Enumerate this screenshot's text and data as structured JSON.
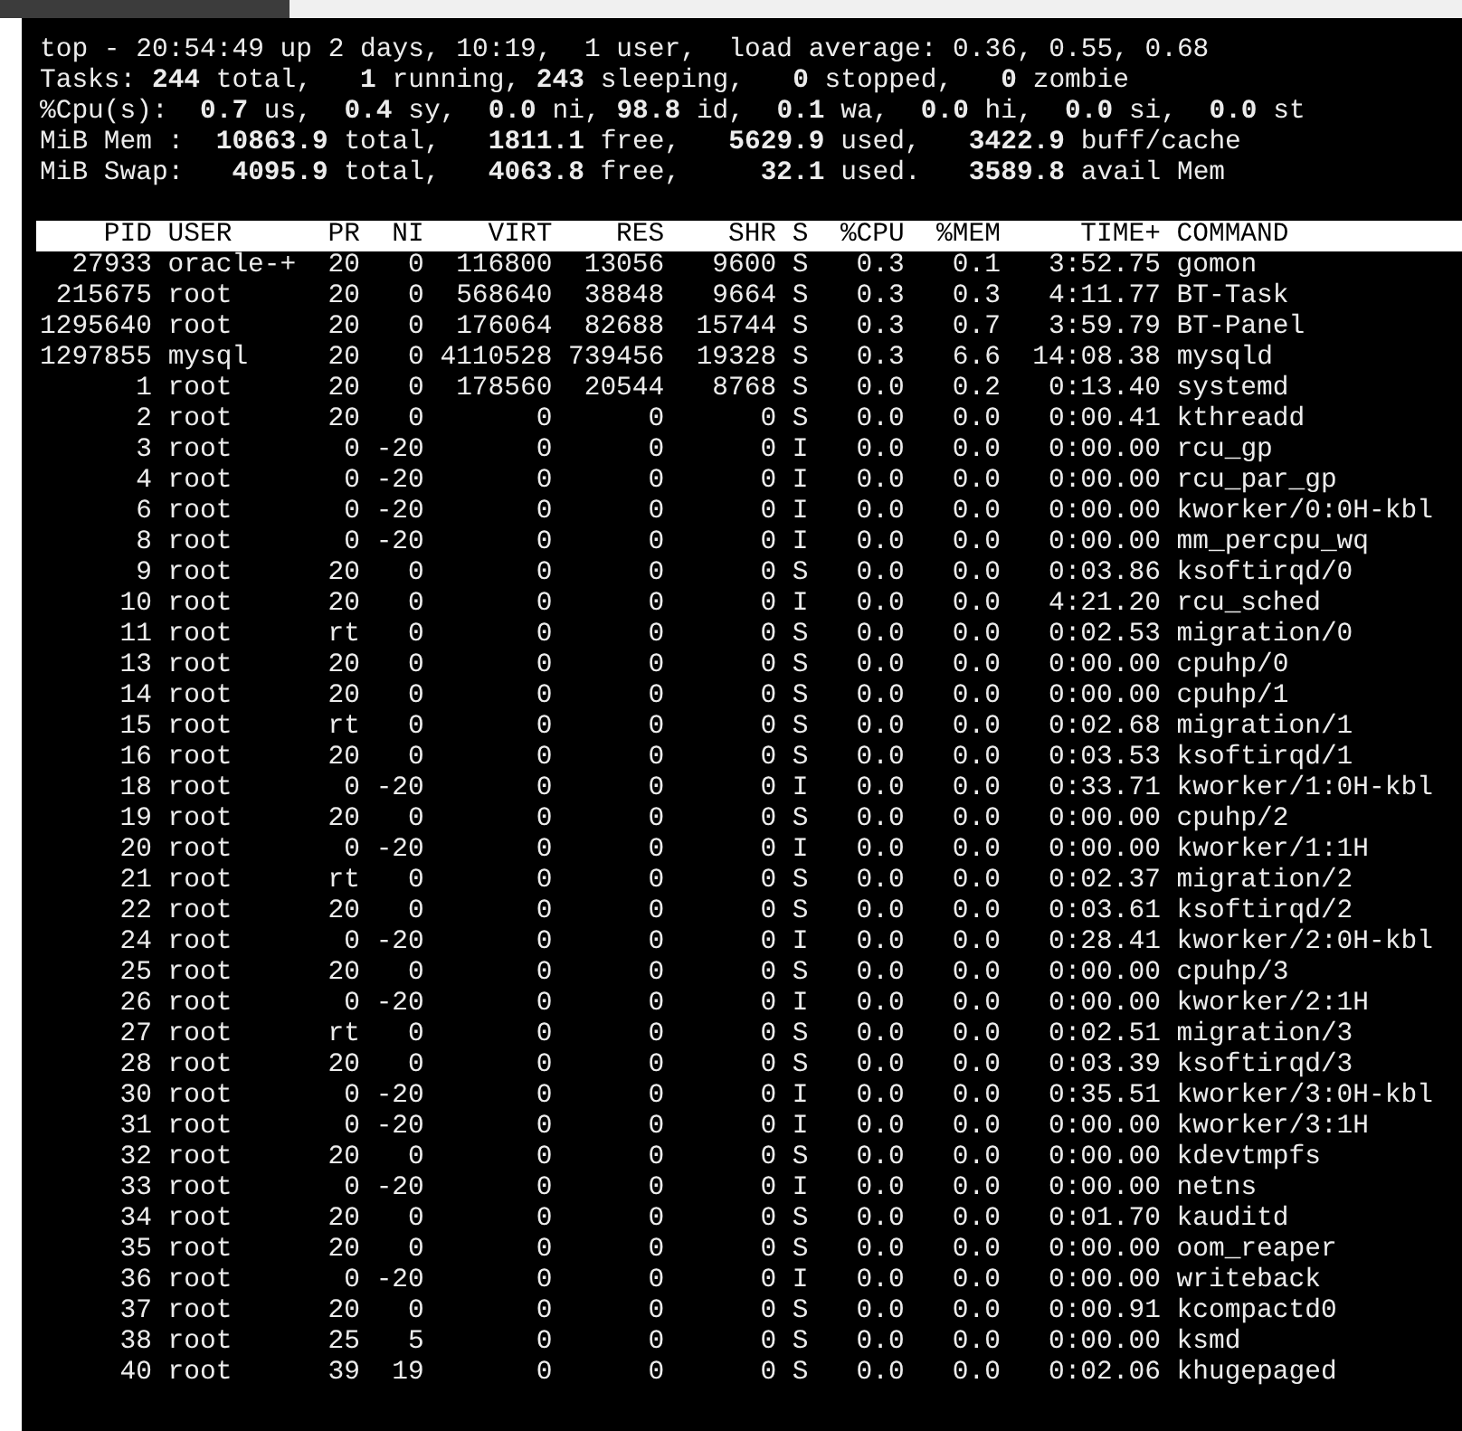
{
  "summary": [
    "top - 20:54:49 up 2 days, 10:19,  1 user,  load average: 0.36, 0.55, 0.68",
    "Tasks: **244** total,   **1** running, **243** sleeping,   **0** stopped,   **0** zombie",
    "%Cpu(s):  **0.7** us,  **0.4** sy,  **0.0** ni, **98.8** id,  **0.1** wa,  **0.0** hi,  **0.0** si,  **0.0** st",
    "MiB Mem :  **10863.9** total,   **1811.1** free,   **5629.9** used,   **3422.9** buff/cache",
    "MiB Swap:   **4095.9** total,   **4063.8** free,     **32.1** used.   **3589.8** avail Mem"
  ],
  "table": {
    "columns": [
      "PID",
      "USER",
      "PR",
      "NI",
      "VIRT",
      "RES",
      "SHR",
      "S",
      "%CPU",
      "%MEM",
      "TIME+",
      "COMMAND"
    ],
    "rows": [
      {
        "cells": [
          "27933",
          "oracle-+",
          "20",
          "0",
          "116800",
          "13056",
          "9600",
          "S",
          "0.3",
          "0.1",
          "3:52.75",
          "gomon"
        ]
      },
      {
        "cells": [
          "215675",
          "root",
          "20",
          "0",
          "568640",
          "38848",
          "9664",
          "S",
          "0.3",
          "0.3",
          "4:11.77",
          "BT-Task"
        ]
      },
      {
        "cells": [
          "1295640",
          "root",
          "20",
          "0",
          "176064",
          "82688",
          "15744",
          "S",
          "0.3",
          "0.7",
          "3:59.79",
          "BT-Panel"
        ]
      },
      {
        "cells": [
          "1297855",
          "mysql",
          "20",
          "0",
          "4110528",
          "739456",
          "19328",
          "S",
          "0.3",
          "6.6",
          "14:08.38",
          "mysqld"
        ]
      },
      {
        "cells": [
          "1",
          "root",
          "20",
          "0",
          "178560",
          "20544",
          "8768",
          "S",
          "0.0",
          "0.2",
          "0:13.40",
          "systemd"
        ]
      },
      {
        "cells": [
          "2",
          "root",
          "20",
          "0",
          "0",
          "0",
          "0",
          "S",
          "0.0",
          "0.0",
          "0:00.41",
          "kthreadd"
        ]
      },
      {
        "cells": [
          "3",
          "root",
          "0",
          "-20",
          "0",
          "0",
          "0",
          "I",
          "0.0",
          "0.0",
          "0:00.00",
          "rcu_gp"
        ]
      },
      {
        "cells": [
          "4",
          "root",
          "0",
          "-20",
          "0",
          "0",
          "0",
          "I",
          "0.0",
          "0.0",
          "0:00.00",
          "rcu_par_gp"
        ]
      },
      {
        "cells": [
          "6",
          "root",
          "0",
          "-20",
          "0",
          "0",
          "0",
          "I",
          "0.0",
          "0.0",
          "0:00.00",
          "kworker/0:0H-kbl"
        ]
      },
      {
        "cells": [
          "8",
          "root",
          "0",
          "-20",
          "0",
          "0",
          "0",
          "I",
          "0.0",
          "0.0",
          "0:00.00",
          "mm_percpu_wq"
        ]
      },
      {
        "cells": [
          "9",
          "root",
          "20",
          "0",
          "0",
          "0",
          "0",
          "S",
          "0.0",
          "0.0",
          "0:03.86",
          "ksoftirqd/0"
        ]
      },
      {
        "cells": [
          "10",
          "root",
          "20",
          "0",
          "0",
          "0",
          "0",
          "I",
          "0.0",
          "0.0",
          "4:21.20",
          "rcu_sched"
        ]
      },
      {
        "cells": [
          "11",
          "root",
          "rt",
          "0",
          "0",
          "0",
          "0",
          "S",
          "0.0",
          "0.0",
          "0:02.53",
          "migration/0"
        ]
      },
      {
        "cells": [
          "13",
          "root",
          "20",
          "0",
          "0",
          "0",
          "0",
          "S",
          "0.0",
          "0.0",
          "0:00.00",
          "cpuhp/0"
        ]
      },
      {
        "cells": [
          "14",
          "root",
          "20",
          "0",
          "0",
          "0",
          "0",
          "S",
          "0.0",
          "0.0",
          "0:00.00",
          "cpuhp/1"
        ]
      },
      {
        "cells": [
          "15",
          "root",
          "rt",
          "0",
          "0",
          "0",
          "0",
          "S",
          "0.0",
          "0.0",
          "0:02.68",
          "migration/1"
        ]
      },
      {
        "cells": [
          "16",
          "root",
          "20",
          "0",
          "0",
          "0",
          "0",
          "S",
          "0.0",
          "0.0",
          "0:03.53",
          "ksoftirqd/1"
        ]
      },
      {
        "cells": [
          "18",
          "root",
          "0",
          "-20",
          "0",
          "0",
          "0",
          "I",
          "0.0",
          "0.0",
          "0:33.71",
          "kworker/1:0H-kbl"
        ]
      },
      {
        "cells": [
          "19",
          "root",
          "20",
          "0",
          "0",
          "0",
          "0",
          "S",
          "0.0",
          "0.0",
          "0:00.00",
          "cpuhp/2"
        ]
      },
      {
        "cells": [
          "20",
          "root",
          "0",
          "-20",
          "0",
          "0",
          "0",
          "I",
          "0.0",
          "0.0",
          "0:00.00",
          "kworker/1:1H"
        ]
      },
      {
        "cells": [
          "21",
          "root",
          "rt",
          "0",
          "0",
          "0",
          "0",
          "S",
          "0.0",
          "0.0",
          "0:02.37",
          "migration/2"
        ]
      },
      {
        "cells": [
          "22",
          "root",
          "20",
          "0",
          "0",
          "0",
          "0",
          "S",
          "0.0",
          "0.0",
          "0:03.61",
          "ksoftirqd/2"
        ]
      },
      {
        "cells": [
          "24",
          "root",
          "0",
          "-20",
          "0",
          "0",
          "0",
          "I",
          "0.0",
          "0.0",
          "0:28.41",
          "kworker/2:0H-kbl"
        ]
      },
      {
        "cells": [
          "25",
          "root",
          "20",
          "0",
          "0",
          "0",
          "0",
          "S",
          "0.0",
          "0.0",
          "0:00.00",
          "cpuhp/3"
        ]
      },
      {
        "cells": [
          "26",
          "root",
          "0",
          "-20",
          "0",
          "0",
          "0",
          "I",
          "0.0",
          "0.0",
          "0:00.00",
          "kworker/2:1H"
        ]
      },
      {
        "cells": [
          "27",
          "root",
          "rt",
          "0",
          "0",
          "0",
          "0",
          "S",
          "0.0",
          "0.0",
          "0:02.51",
          "migration/3"
        ]
      },
      {
        "cells": [
          "28",
          "root",
          "20",
          "0",
          "0",
          "0",
          "0",
          "S",
          "0.0",
          "0.0",
          "0:03.39",
          "ksoftirqd/3"
        ]
      },
      {
        "cells": [
          "30",
          "root",
          "0",
          "-20",
          "0",
          "0",
          "0",
          "I",
          "0.0",
          "0.0",
          "0:35.51",
          "kworker/3:0H-kbl"
        ]
      },
      {
        "cells": [
          "31",
          "root",
          "0",
          "-20",
          "0",
          "0",
          "0",
          "I",
          "0.0",
          "0.0",
          "0:00.00",
          "kworker/3:1H"
        ]
      },
      {
        "cells": [
          "32",
          "root",
          "20",
          "0",
          "0",
          "0",
          "0",
          "S",
          "0.0",
          "0.0",
          "0:00.00",
          "kdevtmpfs"
        ]
      },
      {
        "cells": [
          "33",
          "root",
          "0",
          "-20",
          "0",
          "0",
          "0",
          "I",
          "0.0",
          "0.0",
          "0:00.00",
          "netns"
        ]
      },
      {
        "cells": [
          "34",
          "root",
          "20",
          "0",
          "0",
          "0",
          "0",
          "S",
          "0.0",
          "0.0",
          "0:01.70",
          "kauditd"
        ]
      },
      {
        "cells": [
          "35",
          "root",
          "20",
          "0",
          "0",
          "0",
          "0",
          "S",
          "0.0",
          "0.0",
          "0:00.00",
          "oom_reaper"
        ]
      },
      {
        "cells": [
          "36",
          "root",
          "0",
          "-20",
          "0",
          "0",
          "0",
          "I",
          "0.0",
          "0.0",
          "0:00.00",
          "writeback"
        ]
      },
      {
        "cells": [
          "37",
          "root",
          "20",
          "0",
          "0",
          "0",
          "0",
          "S",
          "0.0",
          "0.0",
          "0:00.91",
          "kcompactd0"
        ]
      },
      {
        "cells": [
          "38",
          "root",
          "25",
          "5",
          "0",
          "0",
          "0",
          "S",
          "0.0",
          "0.0",
          "0:00.00",
          "ksmd"
        ]
      },
      {
        "cells": [
          "40",
          "root",
          "39",
          "19",
          "0",
          "0",
          "0",
          "S",
          "0.0",
          "0.0",
          "0:02.06",
          "khugepaged"
        ]
      }
    ]
  }
}
